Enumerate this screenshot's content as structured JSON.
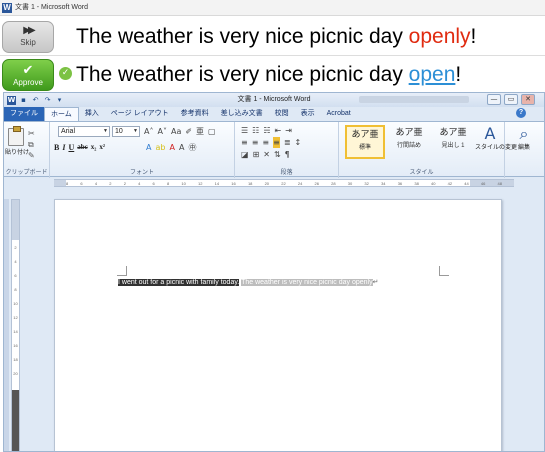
{
  "outer_window": {
    "title": "文書 1 - Microsoft Word",
    "icon_text": "W"
  },
  "suggestions": [
    {
      "button_label": "Skip",
      "button_icon": "fast-forward-icon",
      "sentence_prefix": "The weather is very nice picnic day ",
      "word": "openly",
      "sentence_suffix": "!",
      "word_color": "#e02b10"
    },
    {
      "button_label": "Approve",
      "button_icon": "checkmark-icon",
      "bullet_icon": "check-bullet-icon",
      "sentence_prefix": "The weather is very nice picnic day ",
      "word": "open",
      "sentence_suffix": "!",
      "word_color": "#2c8fd6"
    }
  ],
  "word_window": {
    "title": "文書 1 - Microsoft Word",
    "controls": [
      "—",
      "▭",
      "✕"
    ],
    "tabs": [
      "ファイル",
      "ホーム",
      "挿入",
      "ページ レイアウト",
      "参考資料",
      "差し込み文書",
      "校閲",
      "表示",
      "Acrobat"
    ],
    "active_tab": "ホーム",
    "ribbon": {
      "clipboard": {
        "label": "クリップボード",
        "paste_label": "貼り付け"
      },
      "font": {
        "label": "フォント",
        "font_name": "Arial",
        "font_size": "10",
        "format_buttons": [
          "B",
          "I",
          "U",
          "abc",
          "x₂",
          "x²"
        ]
      },
      "paragraph": {
        "label": "段落"
      },
      "styles": {
        "label": "スタイル",
        "items": [
          {
            "sample": "あア亜",
            "name": "標準"
          },
          {
            "sample": "あア亜",
            "name": "行間詰め"
          },
          {
            "sample": "あア亜",
            "name": "見出し 1"
          }
        ],
        "change_styles_label": "スタイルの変更"
      },
      "editing": {
        "label": "編集"
      }
    },
    "ruler_numbers": [
      "8",
      "6",
      "4",
      "2",
      "2",
      "4",
      "6",
      "8",
      "10",
      "12",
      "14",
      "16",
      "18",
      "20",
      "22",
      "24",
      "26",
      "28",
      "30",
      "32",
      "34",
      "36",
      "38",
      "40",
      "42",
      "44",
      "46",
      "48"
    ],
    "vruler_numbers": [
      "2",
      "4",
      "6",
      "8",
      "10",
      "12",
      "14",
      "16",
      "18",
      "20"
    ],
    "document": {
      "selected_text_1": "I went out for a picnic with family today.",
      "selected_text_2": "The weather is very nice picnic day openly",
      "paragraph_mark": "↵"
    }
  }
}
